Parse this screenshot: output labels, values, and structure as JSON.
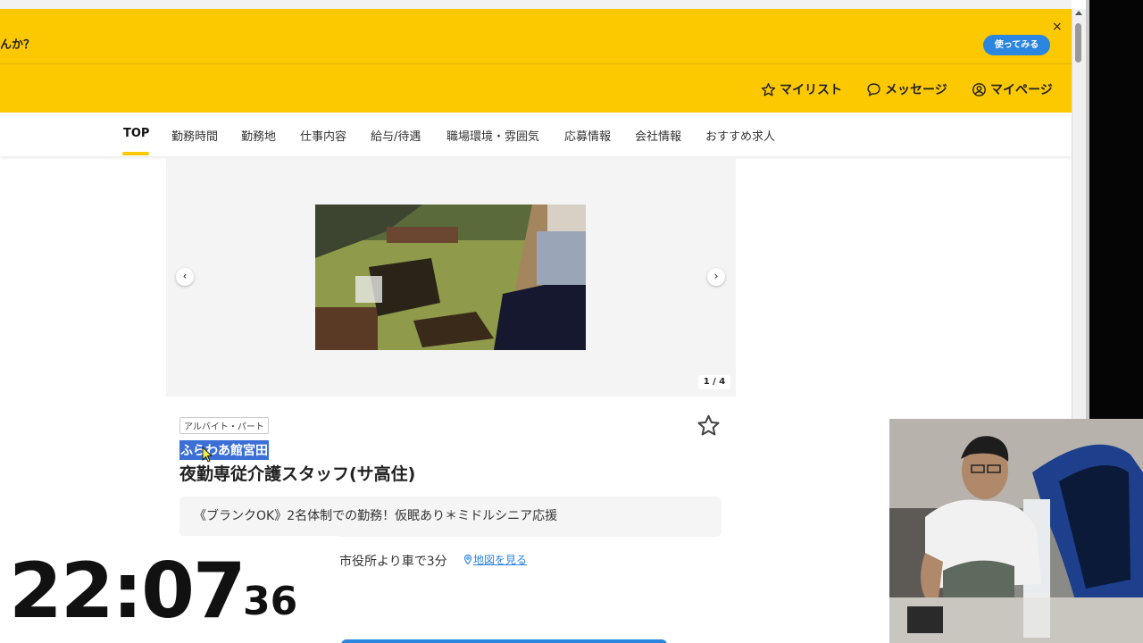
{
  "banner": {
    "text": "んか？",
    "try_button": "使ってみる",
    "close": "×"
  },
  "header": {
    "mylist": "マイリスト",
    "messages": "メッセージ",
    "mypage": "マイページ"
  },
  "tabs": [
    {
      "label": "TOP",
      "active": true
    },
    {
      "label": "勤務時間"
    },
    {
      "label": "勤務地"
    },
    {
      "label": "仕事内容"
    },
    {
      "label": "給与/待遇"
    },
    {
      "label": "職場環境・雰囲気"
    },
    {
      "label": "応募情報"
    },
    {
      "label": "会社情報"
    },
    {
      "label": "おすすめ求人"
    }
  ],
  "gallery": {
    "counter": "1 / 4",
    "prev": "‹",
    "next": "›"
  },
  "job": {
    "tag": "アルバイト・パート",
    "company": "ふらわあ館宮田",
    "title": "夜勤専従介護スタッフ(サ高住)",
    "catch": "《ブランクOK》2名体制での勤務！仮眠あり＊ミドルシニア応援",
    "access": "市役所より車で3分",
    "map_link": "地図を見る"
  },
  "clock": {
    "hm": "22:07",
    "sec": "36"
  },
  "colors": {
    "brand_yellow": "#fcc800",
    "accent_blue": "#2b86e0",
    "selection_blue": "#3b6fd6"
  }
}
